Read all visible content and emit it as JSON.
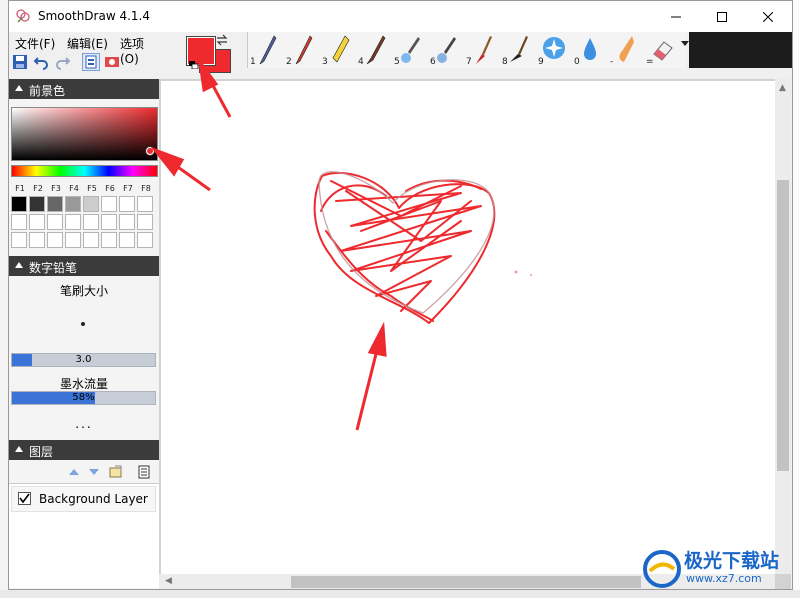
{
  "window": {
    "title": "SmoothDraw 4.1.4"
  },
  "menu": {
    "items": [
      "文件(F)",
      "编辑(E)",
      "选项(O)"
    ]
  },
  "colors": {
    "foreground": "#ee2a2e",
    "background": "#ee2a2e",
    "accent_blue": "#3b74d6",
    "panel_header": "#3b3b3b",
    "annotation_red": "#ee2a2e"
  },
  "brushes": [
    {
      "num": "1",
      "icon": "ballpoint-pen-icon"
    },
    {
      "num": "2",
      "icon": "red-pencil-icon"
    },
    {
      "num": "3",
      "icon": "highlighter-icon"
    },
    {
      "num": "4",
      "icon": "brush-pen-icon"
    },
    {
      "num": "5",
      "icon": "airbrush-icon"
    },
    {
      "num": "6",
      "icon": "spray-gun-icon"
    },
    {
      "num": "7",
      "icon": "paint-brush-icon"
    },
    {
      "num": "8",
      "icon": "oil-brush-icon"
    },
    {
      "num": "9",
      "icon": "star-sparkle-icon"
    },
    {
      "num": "0",
      "icon": "water-drop-icon"
    },
    {
      "num": "-",
      "icon": "smudge-finger-icon"
    },
    {
      "num": "=",
      "icon": "eraser-icon"
    }
  ],
  "panels": {
    "color": {
      "title": "前景色",
      "fkeys": [
        "F1",
        "F2",
        "F3",
        "F4",
        "F5",
        "F6",
        "F7",
        "F8"
      ],
      "palette_row1": [
        "#000000",
        "#333333",
        "#666666",
        "#999999",
        "#cccccc",
        "#ffffff",
        "#ffffff",
        "#ffffff"
      ]
    },
    "brush": {
      "title": "数字铅笔",
      "size_label": "笔刷大小",
      "size_value": "3.0",
      "size_fraction": 0.14,
      "flow_label": "墨水流量",
      "flow_value": "58%",
      "flow_fraction": 0.58,
      "more": "..."
    },
    "layers": {
      "title": "图层",
      "items": [
        {
          "name": "Background Layer",
          "visible": true
        }
      ]
    }
  },
  "watermark": {
    "title": "极光下载站",
    "url": "www.xz7.com"
  }
}
